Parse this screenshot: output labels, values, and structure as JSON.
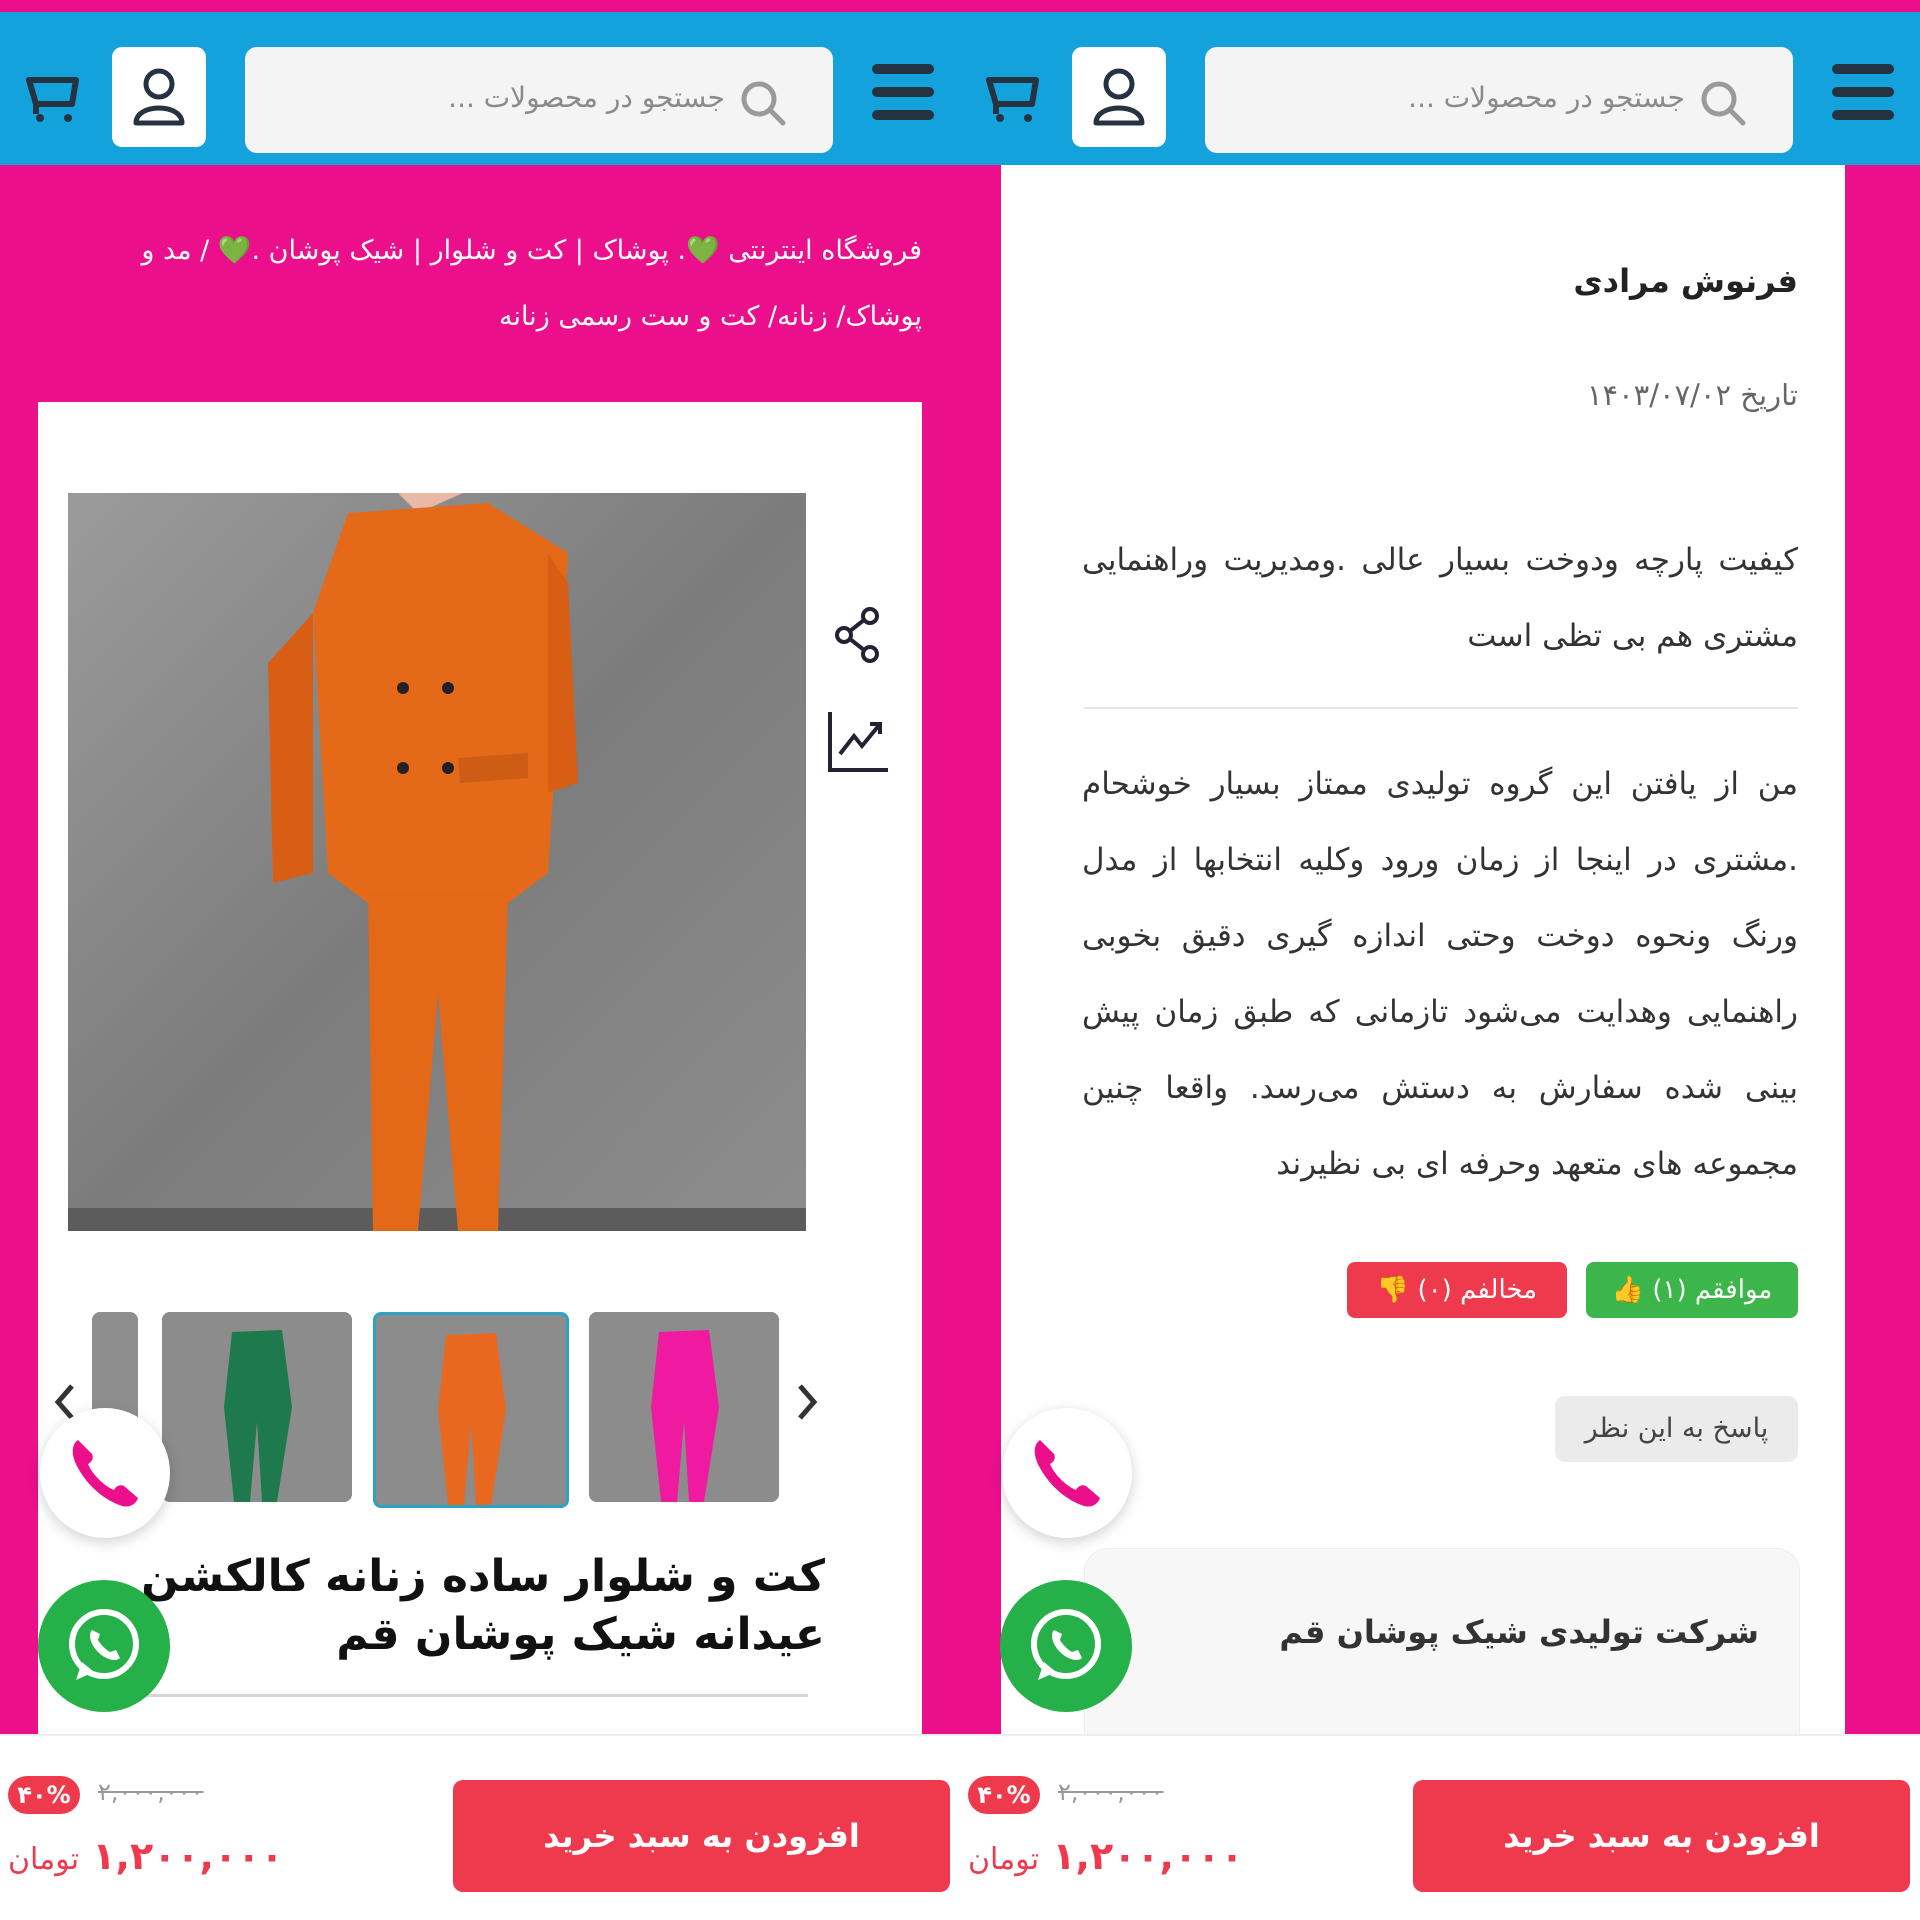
{
  "header": {
    "search_placeholder": "جستجو در محصولات ...",
    "icons": [
      "menu-icon",
      "search-icon",
      "user-icon",
      "cart-icon"
    ]
  },
  "left": {
    "breadcrumb": "فروشگاه اینترنتی 💚. پوشاک | کت و شلوار | شیک پوشان .💚 / مد و پوشاک/ زنانه/ کت و ست رسمی زنانه",
    "product_title": "کت و شلوار ساده زنانه کالکشن عیدانه شیک پوشان قم",
    "thumbnails": [
      {
        "color": "#1e7a4c"
      },
      {
        "color": "#e8681f"
      },
      {
        "color": "#ef1aa0"
      }
    ]
  },
  "right": {
    "author": "فرنوش مرادی",
    "date": "تاریخ ۱۴۰۳/۰۷/۰۲",
    "comment1": "کیفیت پارچه ودوخت بسیار عالی .ومدیریت وراهنمایی مشتری هم بی تظی است",
    "comment2": "من از یافتن این گروه تولیدی ممتاز بسیار خوشحام .مشتری در اینجا از زمان ورود وکلیه انتخابها از مدل ورنگ ونحوه دوخت وحتی اندازه گیری دقیق بخوبی راهنمایی وهدایت می‌شود تازمانی که طبق زمان پیش بینی شده سفارش به دستش می‌رسد. واقعا چنین مجموعه های متعهد وحرفه ای بی نظیرند",
    "agree_label": "موافقم (۱)",
    "disagree_label": "مخالفم (۰)",
    "reply_label": "پاسخ به این نظر",
    "company": "شرکت تولیدی شیک پوشان قم"
  },
  "footer": {
    "add_to_cart": "افزودن به سبد خرید",
    "discount": "۴۰%",
    "old_price": "۲,۰۰۰,۰۰۰",
    "new_price": "۱,۲۰۰,۰۰۰",
    "currency": "تومان"
  },
  "colors": {
    "brand_pink": "#ec0f8c",
    "header_blue": "#13a2dc",
    "cta_red": "#ef3a4e",
    "agree_green": "#3cb54a",
    "whatsapp_green": "#25b049"
  }
}
